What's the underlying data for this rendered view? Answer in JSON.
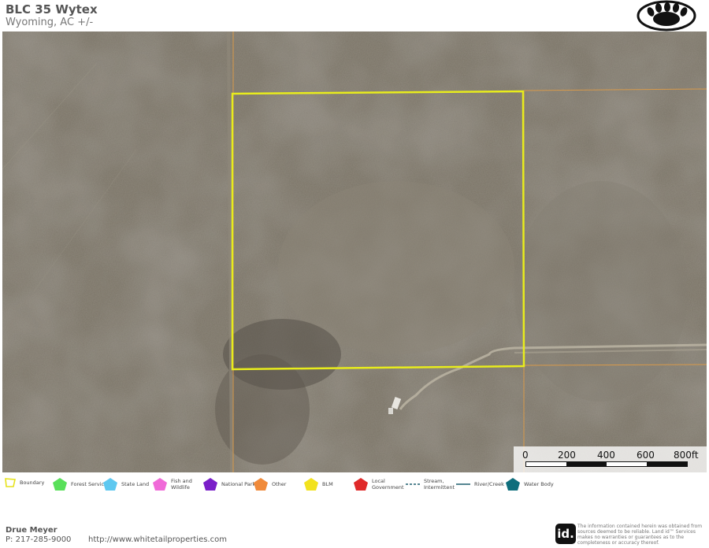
{
  "header": {
    "title": "BLC 35 Wytex",
    "subtitle": "Wyoming,  AC +/-"
  },
  "logo": {
    "icon": "bear-paw-icon"
  },
  "map": {
    "imagery": "aerial-rangeland",
    "boundary_color": "#e8ec1c",
    "parcel_line_color": "#d99a4a",
    "features": [
      "subject-parcel-boundary",
      "adjacent-parcel-lines",
      "dirt-road",
      "ranch-structure"
    ]
  },
  "scale": {
    "labels": [
      "0",
      "200",
      "400",
      "600",
      "800ft"
    ]
  },
  "legend": [
    {
      "label": "Boundary",
      "color": "#e6e21a",
      "shape": "outline"
    },
    {
      "label": "Forest Servic",
      "color": "#59e05a",
      "shape": "pentagon"
    },
    {
      "label": "State Land",
      "color": "#5ec8f0",
      "shape": "pentagon"
    },
    {
      "label": "Fish and Wildlife",
      "color": "#f06ad8",
      "shape": "pentagon"
    },
    {
      "label": "National Park",
      "color": "#7a1fc9",
      "shape": "pentagon"
    },
    {
      "label": "Other",
      "color": "#f08a3a",
      "shape": "pentagon"
    },
    {
      "label": "BLM",
      "color": "#f2e21e",
      "shape": "pentagon"
    },
    {
      "label": "Local Government",
      "color": "#e02a2a",
      "shape": "pentagon"
    },
    {
      "label": "Stream, Intermittent",
      "color": "#1f5f6f",
      "shape": "dashed-line"
    },
    {
      "label": "River/Creek",
      "color": "#1f5f6f",
      "shape": "line"
    },
    {
      "label": "Water Body",
      "color": "#0f6e7c",
      "shape": "pentagon"
    }
  ],
  "footer": {
    "agent_name": "Drue Meyer",
    "phone": "P: 217-285-9000",
    "url": "http://www.whitetailproperties.com",
    "id_logo_text": "id.",
    "disclaimer": "The information contained herein was obtained from sources deemed to be reliable. Land id™ Services makes no warranties or guarantees as to the completeness or accuracy thereof."
  }
}
